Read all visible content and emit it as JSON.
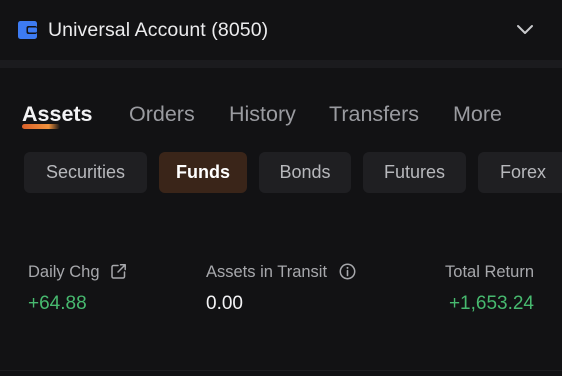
{
  "account": {
    "name": "Universal Account (8050)"
  },
  "main_tabs": [
    {
      "label": "Assets"
    },
    {
      "label": "Orders"
    },
    {
      "label": "History"
    },
    {
      "label": "Transfers"
    },
    {
      "label": "More"
    }
  ],
  "sub_tabs": [
    {
      "label": "Securities"
    },
    {
      "label": "Funds"
    },
    {
      "label": "Bonds"
    },
    {
      "label": "Futures"
    },
    {
      "label": "Forex"
    }
  ],
  "stats": {
    "daily_chg": {
      "label": "Daily Chg",
      "value": "+64.88"
    },
    "assets_in_transit": {
      "label": "Assets in Transit",
      "value": "0.00"
    },
    "total_return": {
      "label": "Total Return",
      "value": "+1,653.24"
    }
  },
  "colors": {
    "background": "#121214",
    "accent": "#f0923d",
    "brand_icon": "#3d7bf2",
    "positive": "#47b96f",
    "active_subtab_bg": "#3a2519"
  },
  "icons": {
    "wallet": "wallet-icon",
    "chevron": "chevron-down-icon",
    "share": "share-icon",
    "info": "info-icon"
  }
}
